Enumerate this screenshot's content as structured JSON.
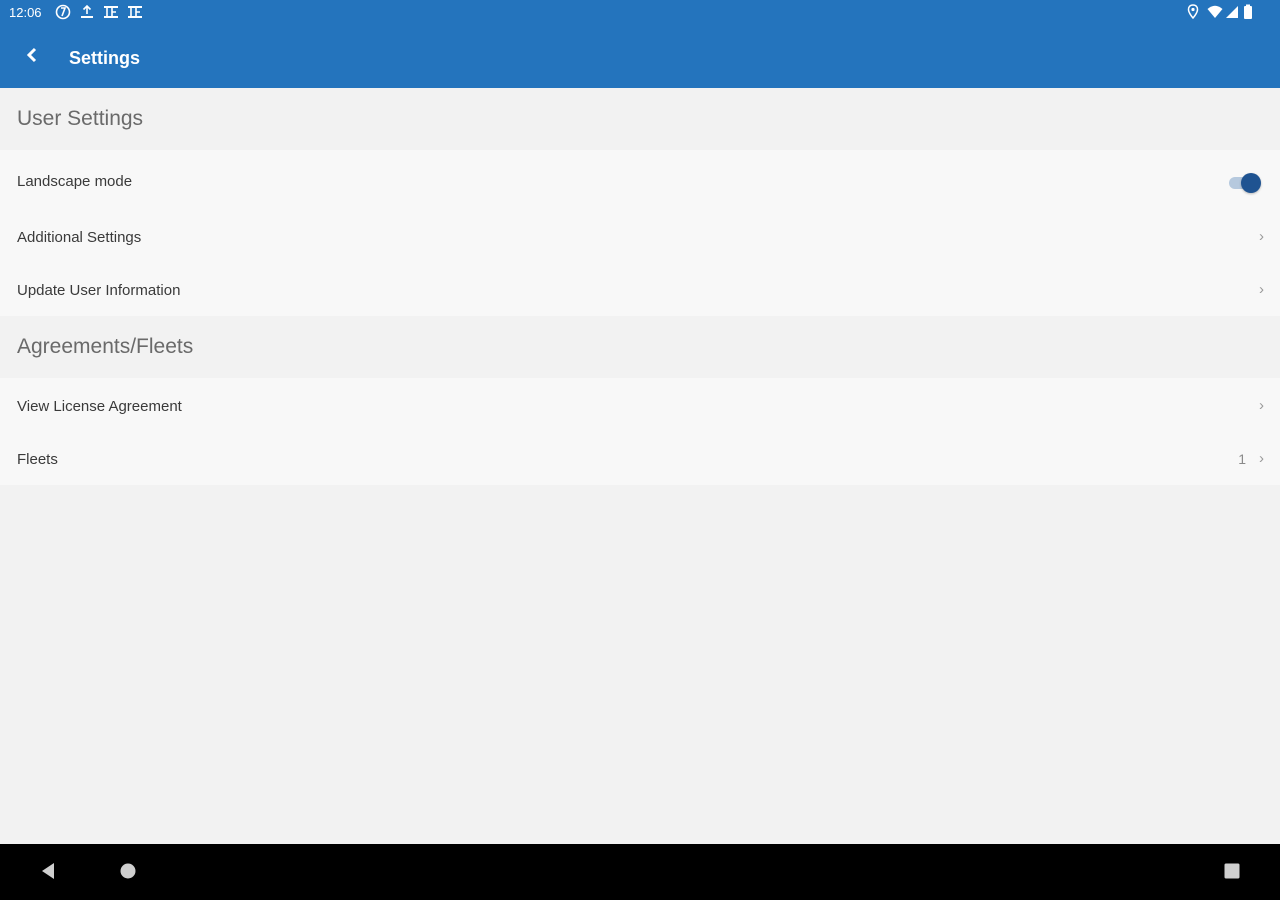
{
  "status_bar": {
    "time": "12:06",
    "left_icons": [
      "sync-icon",
      "upload-icon",
      "app-notification-icon",
      "app-notification-icon"
    ],
    "right_icons": [
      "location-icon",
      "wifi-icon",
      "signal-icon",
      "battery-icon"
    ]
  },
  "app_bar": {
    "title": "Settings",
    "back_icon": "chevron-left-icon",
    "color": "#2474bd"
  },
  "sections": [
    {
      "header": "User Settings",
      "items": [
        {
          "label": "Landscape mode",
          "control": "toggle",
          "checked": true
        },
        {
          "label": "Additional Settings",
          "control": "chevron"
        },
        {
          "label": "Update User Information",
          "control": "chevron"
        }
      ]
    },
    {
      "header": "Agreements/Fleets",
      "items": [
        {
          "label": "View License Agreement",
          "control": "chevron"
        },
        {
          "label": "Fleets",
          "value": "1",
          "control": "chevron"
        }
      ]
    }
  ],
  "chevron_glyph": "›",
  "nav_bar": {
    "buttons": [
      "back-triangle-icon",
      "home-circle-icon",
      "recents-square-icon"
    ]
  }
}
